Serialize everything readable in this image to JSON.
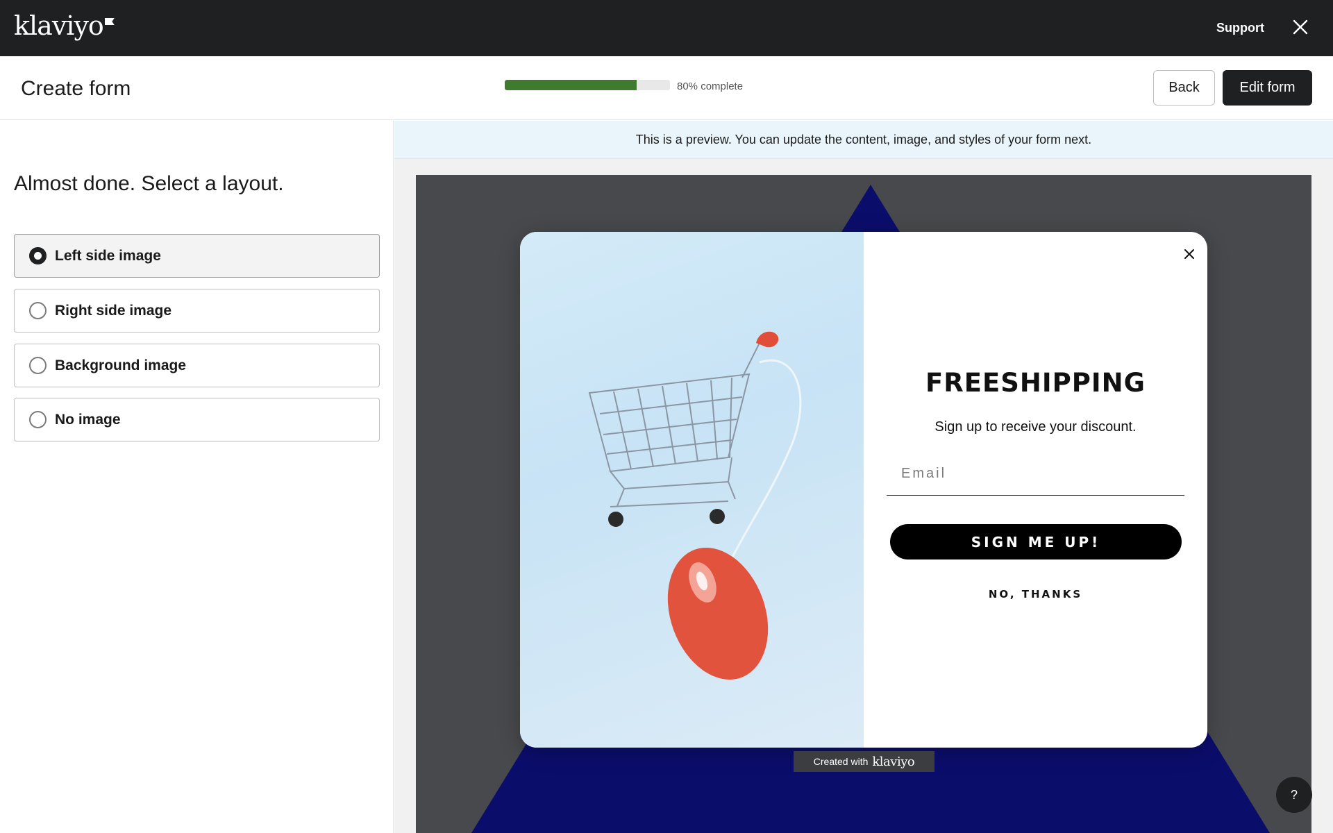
{
  "app": {
    "logo_text": "klaviyo",
    "support_label": "Support"
  },
  "header": {
    "title": "Create form",
    "progress_percent": 80,
    "progress_label": "80% complete",
    "back_label": "Back",
    "edit_label": "Edit form"
  },
  "panel": {
    "heading": "Almost done. Select a layout.",
    "options": [
      {
        "label": "Left side image",
        "selected": true
      },
      {
        "label": "Right side image",
        "selected": false
      },
      {
        "label": "Background image",
        "selected": false
      },
      {
        "label": "No image",
        "selected": false
      }
    ]
  },
  "preview": {
    "banner": "This is a preview. You can update the content, image, and styles of your form next.",
    "modal": {
      "heading": "FREESHIPPING",
      "subheading": "Sign up to receive your discount.",
      "email_placeholder": "Email",
      "signup_label": "SIGN ME UP!",
      "decline_label": "NO, THANKS",
      "image_subject": "shopping-cart-and-mouse-image"
    },
    "created_with": "Created with",
    "created_with_logo": "klaviyo"
  },
  "help_label": "?",
  "colors": {
    "topbar": "#1f2022",
    "progress": "#3f7a2f",
    "canvas_bg": "#48494c",
    "triangle": "#0b0d6b",
    "banner": "#eaf5fb"
  }
}
